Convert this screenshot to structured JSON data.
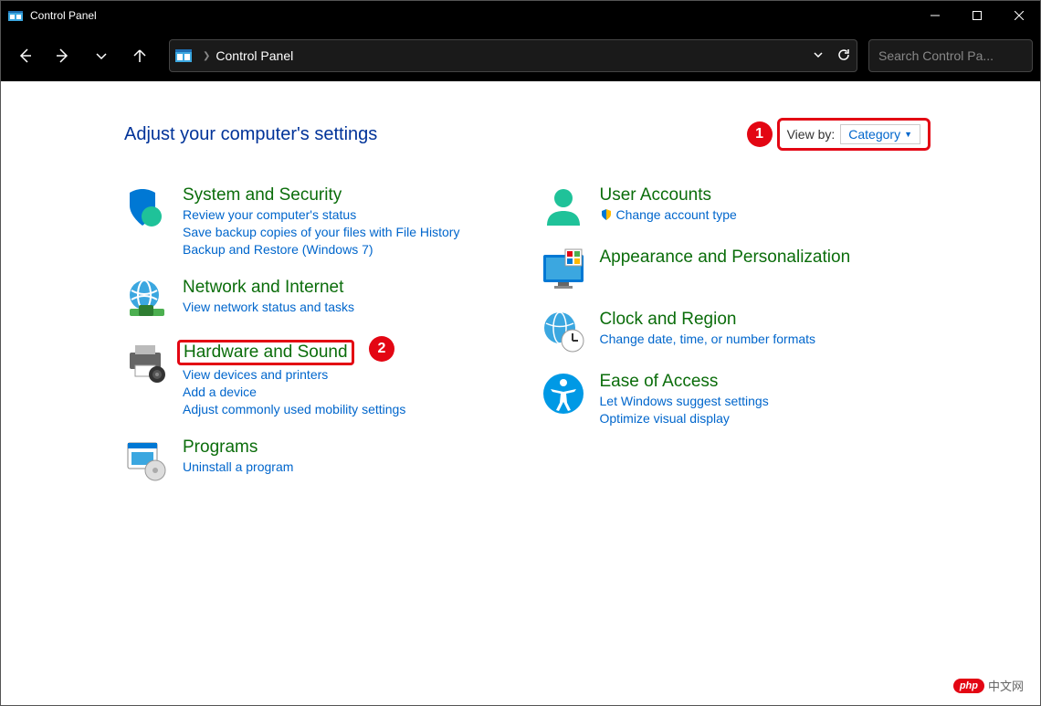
{
  "window": {
    "title": "Control Panel"
  },
  "addressbar": {
    "location": "Control Panel"
  },
  "search": {
    "placeholder": "Search Control Pa..."
  },
  "heading": "Adjust your computer's settings",
  "view_by": {
    "label": "View by:",
    "value": "Category"
  },
  "markers": {
    "m1": "1",
    "m2": "2"
  },
  "categories": {
    "system": {
      "title": "System and Security",
      "links": [
        "Review your computer's status",
        "Save backup copies of your files with File History",
        "Backup and Restore (Windows 7)"
      ]
    },
    "network": {
      "title": "Network and Internet",
      "links": [
        "View network status and tasks"
      ]
    },
    "hardware": {
      "title": "Hardware and Sound",
      "links": [
        "View devices and printers",
        "Add a device",
        "Adjust commonly used mobility settings"
      ]
    },
    "programs": {
      "title": "Programs",
      "links": [
        "Uninstall a program"
      ]
    },
    "user": {
      "title": "User Accounts",
      "links": [
        "Change account type"
      ]
    },
    "appearance": {
      "title": "Appearance and Personalization",
      "links": []
    },
    "clock": {
      "title": "Clock and Region",
      "links": [
        "Change date, time, or number formats"
      ]
    },
    "ease": {
      "title": "Ease of Access",
      "links": [
        "Let Windows suggest settings",
        "Optimize visual display"
      ]
    }
  },
  "watermark": {
    "pill": "php",
    "text": "中文网"
  }
}
